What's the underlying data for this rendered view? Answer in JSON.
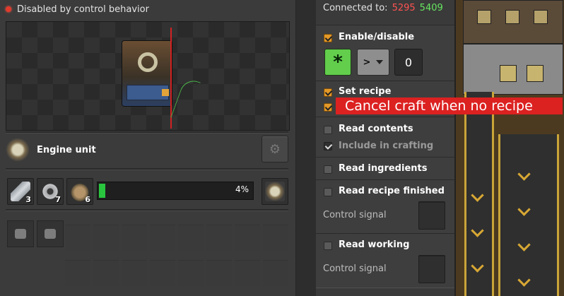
{
  "status": {
    "text": "Disabled by control behavior",
    "color": "#e23a2c"
  },
  "recipe": {
    "name": "Engine unit",
    "icon": "engine-unit-icon"
  },
  "ingredients": [
    {
      "icon": "pipe-icon",
      "count": "3"
    },
    {
      "icon": "iron-gear-wheel-icon",
      "count": "7"
    },
    {
      "icon": "steel-plate-icon",
      "count": "6"
    }
  ],
  "progress": {
    "percent_label": "4%",
    "value": 0.04,
    "color": "#29c53e"
  },
  "output": {
    "icon": "engine-unit-icon"
  },
  "circuit": {
    "connected_label": "Connected to:",
    "red_network": "5295",
    "green_network": "5409",
    "enable_disable": {
      "label": "Enable/disable",
      "checked": true,
      "signal_icon": "everything-signal-icon",
      "comparator": ">",
      "constant": "0"
    },
    "set_recipe": {
      "label": "Set recipe",
      "checked": true
    },
    "cancel_craft": {
      "label": "Cancel craft when no recipe",
      "checked": true
    },
    "read_contents": {
      "label": "Read contents",
      "checked": false
    },
    "include_in_crafting": {
      "label": "Include in crafting",
      "checked": true,
      "disabled": true
    },
    "read_ingredients": {
      "label": "Read ingredients",
      "checked": false
    },
    "read_recipe_finished": {
      "label": "Read recipe finished",
      "checked": false,
      "signal_label": "Control signal"
    },
    "read_working": {
      "label": "Read working",
      "checked": false,
      "signal_label": "Control signal"
    }
  },
  "tooltip": {
    "text": "Cancel craft when no recipe",
    "color": "#dc2121"
  }
}
